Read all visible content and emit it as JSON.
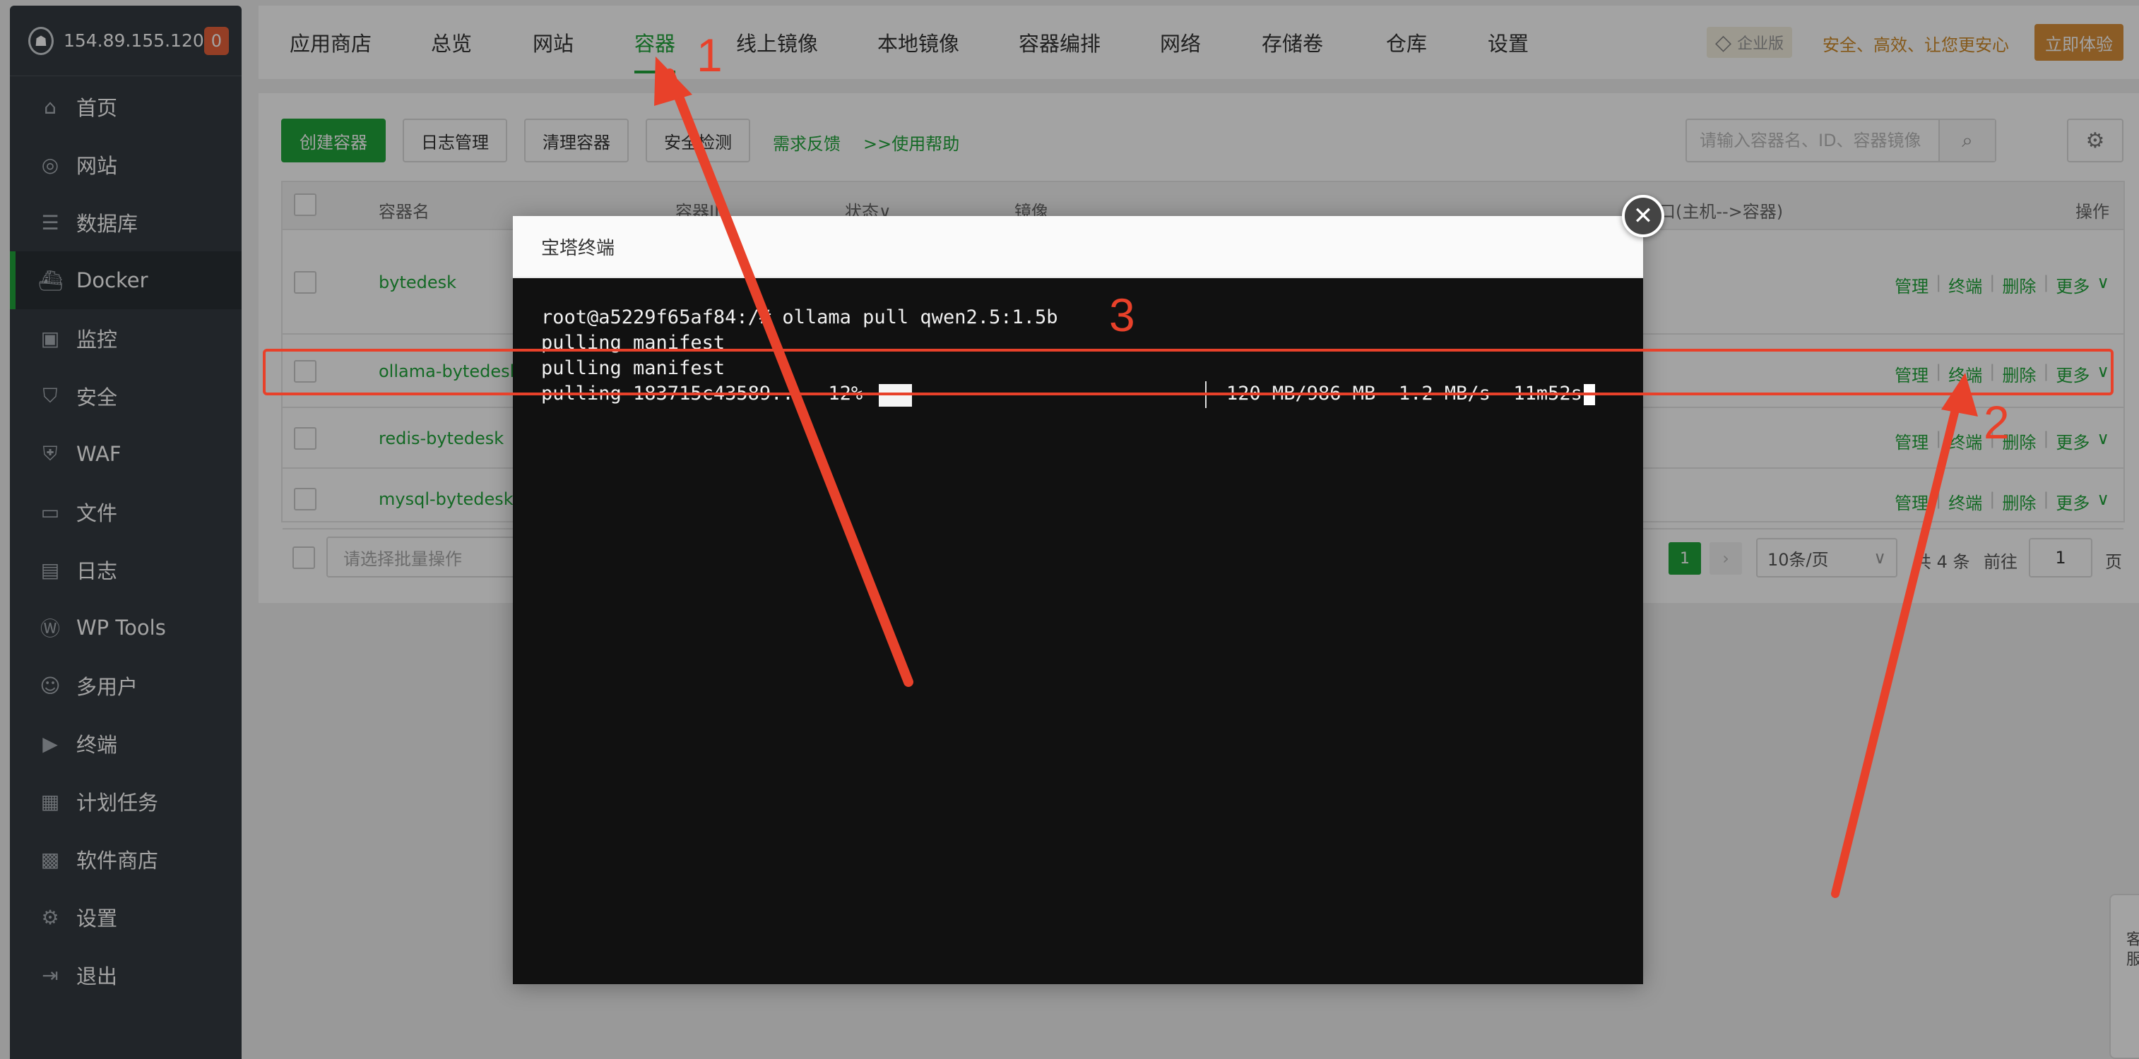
{
  "sidebar": {
    "ip": "154.89.155.120",
    "badge": "0",
    "items": [
      {
        "label": "首页",
        "icon": "home-icon",
        "glyph": "⌂"
      },
      {
        "label": "网站",
        "icon": "globe-icon",
        "glyph": "◎"
      },
      {
        "label": "数据库",
        "icon": "database-icon",
        "glyph": "☰"
      },
      {
        "label": "Docker",
        "icon": "docker-icon",
        "glyph": "⛴"
      },
      {
        "label": "监控",
        "icon": "monitor-icon",
        "glyph": "▣"
      },
      {
        "label": "安全",
        "icon": "shield-icon",
        "glyph": "⛉"
      },
      {
        "label": "WAF",
        "icon": "waf-icon",
        "glyph": "⛨"
      },
      {
        "label": "文件",
        "icon": "folder-icon",
        "glyph": "▭"
      },
      {
        "label": "日志",
        "icon": "log-icon",
        "glyph": "▤"
      },
      {
        "label": "WP Tools",
        "icon": "wordpress-icon",
        "glyph": "Ⓦ"
      },
      {
        "label": "多用户",
        "icon": "users-icon",
        "glyph": "☺"
      },
      {
        "label": "终端",
        "icon": "terminal-icon",
        "glyph": "▶"
      },
      {
        "label": "计划任务",
        "icon": "calendar-icon",
        "glyph": "▦"
      },
      {
        "label": "软件商店",
        "icon": "apps-icon",
        "glyph": "▩"
      },
      {
        "label": "设置",
        "icon": "gear-icon",
        "glyph": "⚙"
      },
      {
        "label": "退出",
        "icon": "logout-icon",
        "glyph": "⇥"
      }
    ]
  },
  "topbar": {
    "tabs": [
      "应用商店",
      "总览",
      "网站",
      "容器",
      "线上镜像",
      "本地镜像",
      "容器编排",
      "网络",
      "存储卷",
      "仓库",
      "设置"
    ],
    "enterprise_tag": "企业版",
    "slogan": "安全、高效、让您更安心",
    "try_label": "立即体验"
  },
  "toolbar": {
    "create": "创建容器",
    "log_manage": "日志管理",
    "clean": "清理容器",
    "security_check": "安全检测",
    "feedback": "需求反馈",
    "help": ">>使用帮助",
    "search_placeholder": "请输入容器名、ID、容器镜像"
  },
  "table": {
    "headers": {
      "name": "容器名",
      "id": "容器ID",
      "status": "状态",
      "image": "镜像",
      "ports": "端口(主机-->容器)",
      "ops": "操作"
    },
    "rows": [
      {
        "name": "bytedesk"
      },
      {
        "name": "ollama-bytedesk"
      },
      {
        "name": "redis-bytedesk"
      },
      {
        "name": "mysql-bytedesk"
      }
    ],
    "ops": {
      "manage": "管理",
      "terminal": "终端",
      "delete": "删除",
      "more": "更多"
    }
  },
  "footer": {
    "batch_placeholder": "请选择批量操作",
    "page": "1",
    "per_page": "10条/页",
    "total": "共 4 条",
    "goto": "前往",
    "goto_value": "1",
    "page_unit": "页"
  },
  "modal": {
    "title": "宝塔终端",
    "lines": [
      "root@a5229f65af84:/# ollama pull qwen2.5:1.5b",
      "pulling manifest",
      "pulling manifest"
    ],
    "progress_left": "pulling 183715c43589...  12%",
    "progress_right": "120 MB/986 MB  1.2 MB/s  11m52s",
    "progress_value": 0.12
  },
  "service": {
    "label": "客服"
  },
  "annotations": {
    "n1": "1",
    "n2": "2",
    "n3": "3",
    "color": "#e8412a"
  },
  "colors": {
    "accent": "#20a53a",
    "sidebar": "#343a40",
    "enterprise": "#d9903a"
  }
}
